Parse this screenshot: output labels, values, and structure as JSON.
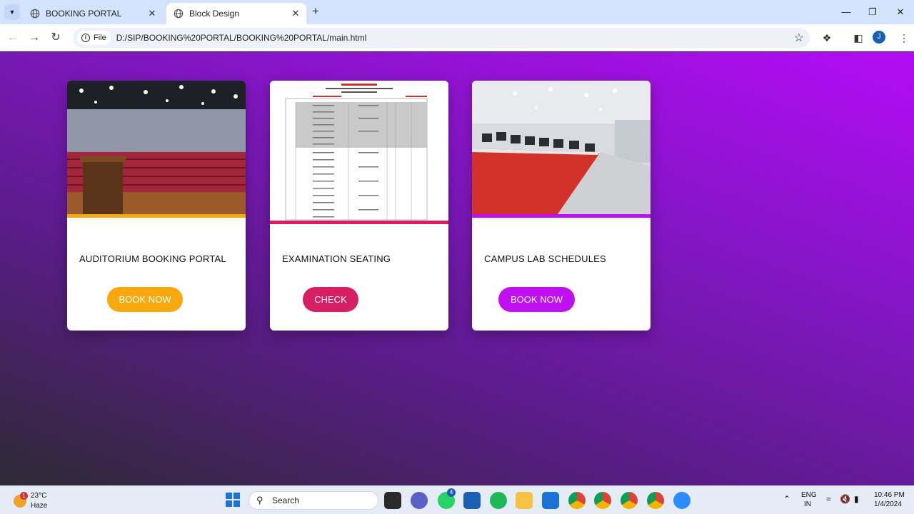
{
  "browser": {
    "tabs": [
      {
        "title": "BOOKING PORTAL",
        "active": false
      },
      {
        "title": "Block Design",
        "active": true
      }
    ],
    "address": {
      "chip_label": "File",
      "url": "D:/SIP/BOOKING%20PORTAL/BOOKING%20PORTAL/main.html"
    },
    "profile_initial": "J"
  },
  "page": {
    "cards": [
      {
        "title": "AUDITORIUM BOOKING PORTAL",
        "button": "BOOK NOW",
        "accent": "#f7a80c",
        "image": "auditorium-photo"
      },
      {
        "title": "EXAMINATION SEATING",
        "button": "CHECK",
        "accent": "#d61f63",
        "image": "seating-plan-document"
      },
      {
        "title": "CAMPUS LAB SCHEDULES",
        "button": "BOOK NOW",
        "accent": "#c00ff0",
        "image": "computer-lab-photo"
      }
    ]
  },
  "taskbar": {
    "weather": {
      "temp": "23°C",
      "condition": "Haze",
      "badge": "1"
    },
    "search_placeholder": "Search",
    "whatsapp_badge": "4",
    "language": {
      "line1": "ENG",
      "line2": "IN"
    },
    "clock": {
      "time": "10:46 PM",
      "date": "1/4/2024"
    }
  }
}
